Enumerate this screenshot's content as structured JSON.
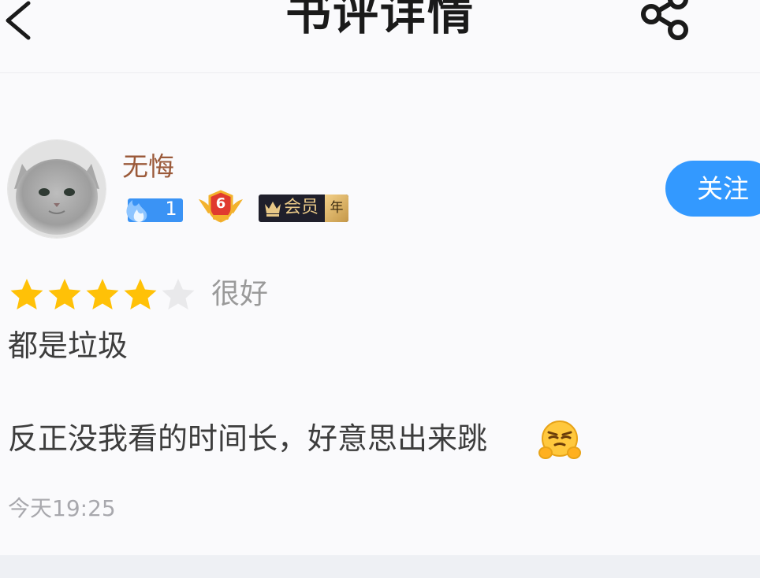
{
  "header": {
    "title": "书评详情",
    "back_icon": "chevron-left-icon",
    "share_icon": "share-icon"
  },
  "user": {
    "name": "无悔",
    "fans_level": "1",
    "honor_level": "6",
    "vip_label": "会员",
    "vip_period": "年",
    "follow_label": "关注"
  },
  "rating": {
    "stars": 4,
    "max": 5,
    "label": "很好"
  },
  "review": {
    "lines": [
      "都是垃圾",
      "反正没我看的时间长，好意思出来跳"
    ],
    "emoji": "smug-face-emoji",
    "time": "今天19:25"
  },
  "colors": {
    "accent": "#3399ff",
    "star": "#ffc107",
    "username": "#9b5a3a"
  }
}
